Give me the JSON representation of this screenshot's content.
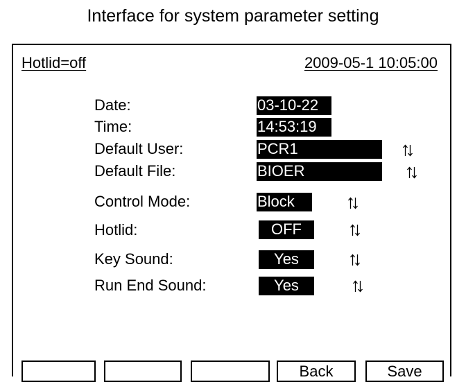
{
  "caption": "Interface for system parameter setting",
  "status_bar": {
    "hotlid": "Hotlid=off",
    "datetime": "2009-05-1 10:05:00"
  },
  "settings": [
    {
      "label": "Date:",
      "value": "03-10-22",
      "adjustable": false
    },
    {
      "label": "Time:",
      "value": "14:53:19",
      "adjustable": false
    },
    {
      "label": "Default User:",
      "value": "PCR1",
      "adjustable": true
    },
    {
      "label": "Default File:",
      "value": "BIOER",
      "adjustable": true
    },
    {
      "label": "Control Mode:",
      "value": "Block",
      "adjustable": true
    },
    {
      "label": "Hotlid:",
      "value": "OFF",
      "adjustable": true
    },
    {
      "label": "Key Sound:",
      "value": "Yes",
      "adjustable": true
    },
    {
      "label": "Run End Sound:",
      "value": "Yes",
      "adjustable": true
    }
  ],
  "icons": {
    "adjust": "up-down-arrows-icon"
  },
  "softkeys": {
    "f1": "",
    "f2": "",
    "f3": "",
    "f4": "Back",
    "f5": "Save"
  },
  "colors": {
    "highlight_bg": "#000000",
    "highlight_fg": "#ffffff"
  }
}
